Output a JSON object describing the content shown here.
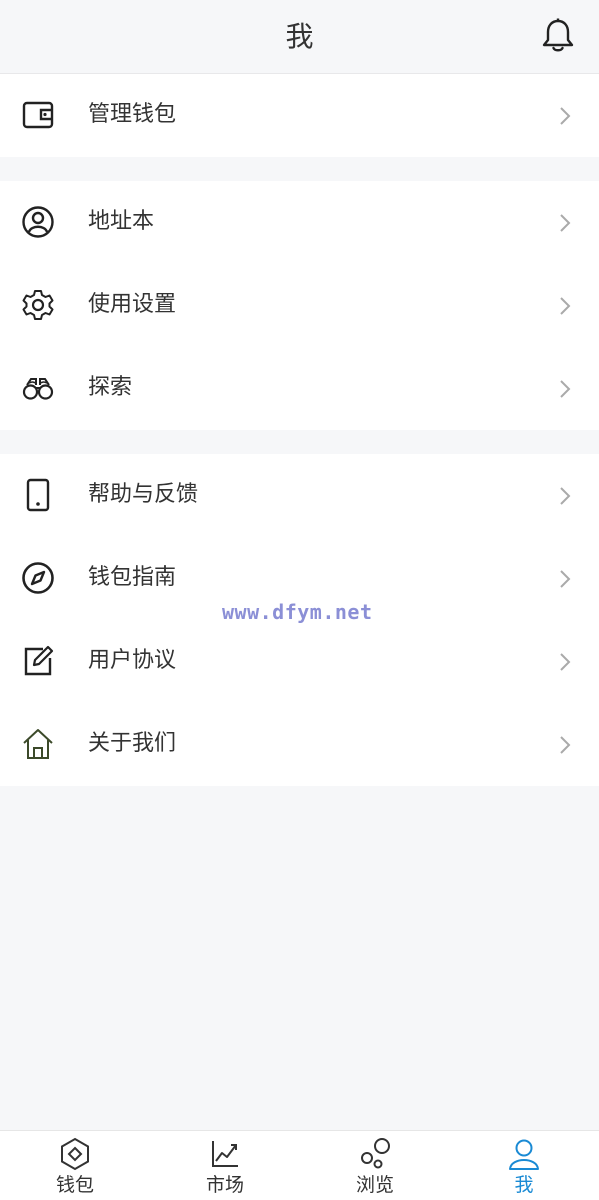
{
  "header": {
    "title": "我"
  },
  "groups": [
    {
      "items": [
        {
          "label": "管理钱包"
        }
      ]
    },
    {
      "items": [
        {
          "label": "地址本"
        },
        {
          "label": "使用设置"
        },
        {
          "label": "探索"
        }
      ]
    },
    {
      "items": [
        {
          "label": "帮助与反馈"
        },
        {
          "label": "钱包指南"
        },
        {
          "label": "用户协议"
        },
        {
          "label": "关于我们"
        }
      ]
    }
  ],
  "watermark": "www.dfym.net",
  "tabs": [
    {
      "label": "钱包"
    },
    {
      "label": "市场"
    },
    {
      "label": "浏览"
    },
    {
      "label": "我",
      "active": true
    }
  ],
  "colors": {
    "accent": "#1a8ad4",
    "background": "#f6f7f9",
    "text": "#333333"
  }
}
